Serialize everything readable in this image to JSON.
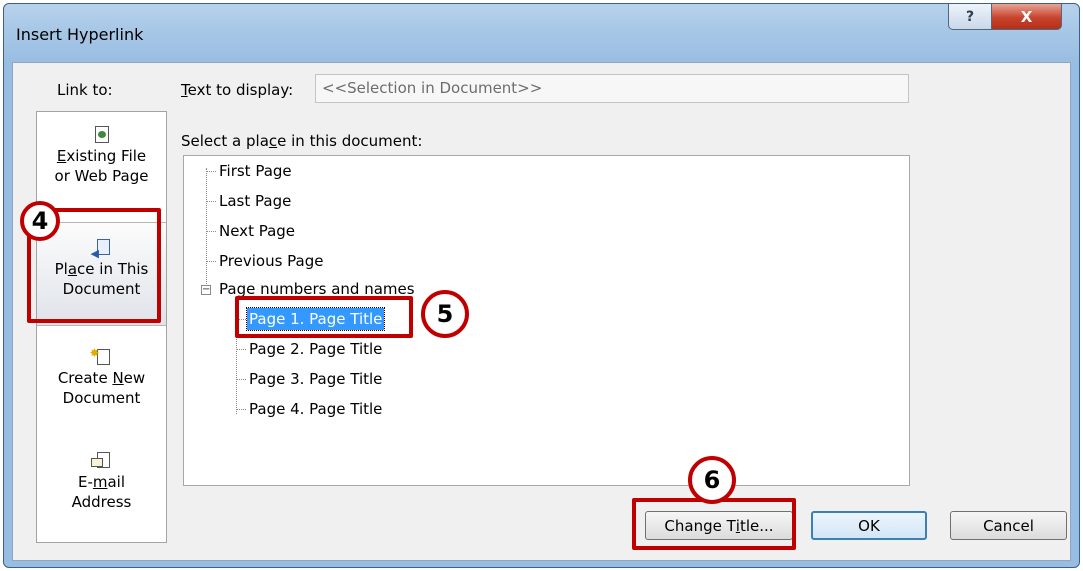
{
  "window": {
    "title": "Insert Hyperlink",
    "help_glyph": "?",
    "close_glyph": "X"
  },
  "sidebar": {
    "label": "Link to:",
    "items": [
      {
        "line1_pre": "",
        "line1_u": "E",
        "line1_post": "xisting File",
        "line2": "or Web Page",
        "icon": "existing-file-icon"
      },
      {
        "line1_pre": "Pl",
        "line1_u": "a",
        "line1_post": "ce in This",
        "line2": "Document",
        "icon": "place-in-document-icon",
        "selected": true
      },
      {
        "line1_pre": "Create ",
        "line1_u": "N",
        "line1_post": "ew",
        "line2": "Document",
        "icon": "new-document-icon"
      },
      {
        "line1_pre": "E-",
        "line1_u": "m",
        "line1_post": "ail",
        "line2": "Address",
        "icon": "email-address-icon"
      }
    ]
  },
  "text_to_display": {
    "label_u": "T",
    "label_rest": "ext to display:",
    "value": "<<Selection in Document>>"
  },
  "select_place": {
    "label_pre": "Select a pla",
    "label_u": "c",
    "label_post": "e in this document:"
  },
  "tree": {
    "items": [
      {
        "label": "First Page"
      },
      {
        "label": "Last Page"
      },
      {
        "label": "Next Page"
      },
      {
        "label": "Previous Page"
      },
      {
        "label": "Page numbers and names",
        "expanded": true
      },
      {
        "label": "Page 1. Page Title",
        "selected": true
      },
      {
        "label": "Page 2. Page Title"
      },
      {
        "label": "Page 3. Page Title"
      },
      {
        "label": "Page 4. Page Title"
      }
    ],
    "expander_glyph": "−"
  },
  "buttons": {
    "change_title_pre": "Change T",
    "change_title_u": "i",
    "change_title_post": "tle...",
    "ok": "OK",
    "cancel": "Cancel"
  },
  "callouts": [
    "4",
    "5",
    "6"
  ],
  "colors": {
    "callout": "#c00000",
    "selection": "#3399ff"
  }
}
